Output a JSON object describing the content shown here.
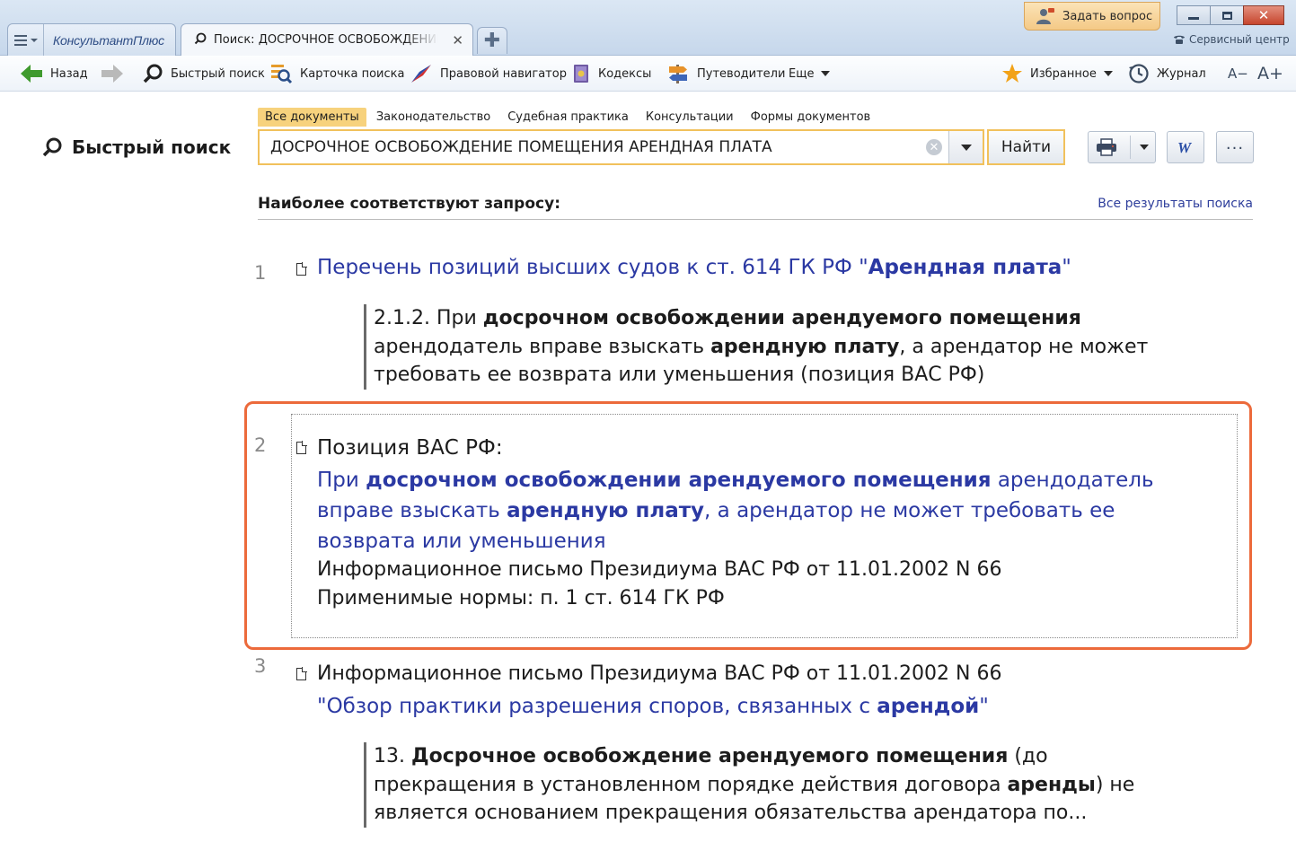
{
  "window": {
    "tabs": [
      {
        "brand": "КонсультантПлюс"
      },
      {
        "title": "Поиск: ДОСРОЧНОЕ ОСВОБОЖДЕНИЕ ПОМЕЩЕНИЯ АРЕНДНАЯ ПЛАТА"
      }
    ],
    "ask_label": "Задать вопрос",
    "service_center": "Сервисный центр"
  },
  "toolbar": {
    "back": "Назад",
    "quick_search": "Быстрый поиск",
    "search_card": "Карточка поиска",
    "legal_navigator": "Правовой навигатор",
    "codes": "Кодексы",
    "guides": "Путеводители",
    "more": "Еще",
    "favorites": "Избранное",
    "journal": "Журнал",
    "font_smaller": "A−",
    "font_bigger": "A+"
  },
  "page": {
    "title": "Быстрый поиск",
    "scope_tabs": [
      "Все документы",
      "Законодательство",
      "Судебная практика",
      "Консультации",
      "Формы документов"
    ],
    "search_value": "ДОСРОЧНОЕ ОСВОБОЖДЕНИЕ ПОМЕЩЕНИЯ АРЕНДНАЯ ПЛАТА",
    "find_label": "Найти",
    "results_heading": "Наиболее соответствуют запросу:",
    "all_results_link": "Все результаты поиска"
  },
  "results": [
    {
      "num": "1",
      "title_plain": "Перечень позиций высших судов к ст. 614 ГК РФ \"",
      "title_bold": "Арендная плата",
      "title_end": "\"",
      "quote": [
        [
          "2.1.2. При ",
          "досрочном освобождении арендуемого помещения"
        ],
        [
          "арендодатель вправе взыскать ",
          "арендную плату",
          ", а арендатор не может"
        ],
        [
          "требовать ее возврата или уменьшения (позиция ВАС РФ)"
        ]
      ]
    },
    {
      "num": "2",
      "title": "Позиция ВАС РФ:",
      "lines": [
        [
          "При ",
          "досрочном освобождении арендуемого помещения",
          " арендодатель"
        ],
        [
          "вправе взыскать ",
          "арендную плату",
          ", а арендатор не может требовать ее"
        ],
        [
          "возврата или уменьшения"
        ]
      ],
      "source": "Информационное письмо Президиума ВАС РФ от 11.01.2002 N 66",
      "norms": "Применимые нормы: п. 1 ст. 614 ГК РФ"
    },
    {
      "num": "3",
      "title": "Информационное письмо Президиума ВАС РФ от 11.01.2002 N 66",
      "subtitle_plain": "\"Обзор практики разрешения споров, связанных с ",
      "subtitle_bold": "арендой",
      "subtitle_end": "\"",
      "quote": [
        [
          "13. ",
          "Досрочное освобождение арендуемого помещения",
          " (до"
        ],
        [
          "прекращения в установленном порядке действия договора ",
          "аренды",
          ") не"
        ],
        [
          "является основанием прекращения обязательства арендатора по..."
        ]
      ]
    }
  ],
  "colors": {
    "link": "#2b39a3",
    "highlight": "#ec6a3b",
    "search_border": "#f1c15c",
    "active_scope": "#f7d27d"
  }
}
